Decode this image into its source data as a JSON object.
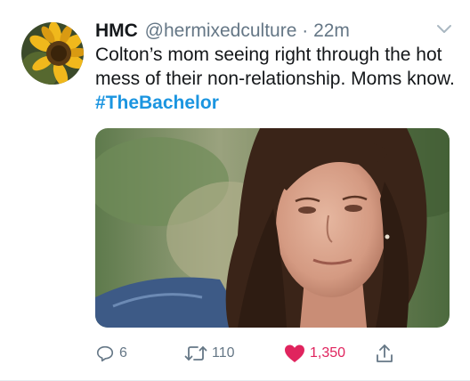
{
  "tweet": {
    "display_name": "HMC",
    "handle": "@hermixedculture",
    "separator": "·",
    "time": "22m",
    "text": "Colton’s mom seeing right through the hot mess of their non-relationship. Moms know. ",
    "hashtag": "#TheBachelor",
    "media_icon": "photo-of-woman"
  },
  "actions": {
    "reply": {
      "icon": "reply-icon",
      "count": "6"
    },
    "retweet": {
      "icon": "retweet-icon",
      "count": "110"
    },
    "like": {
      "icon": "heart-icon",
      "count": "1,350",
      "color": "#e0245e"
    },
    "share": {
      "icon": "share-icon"
    }
  },
  "colors": {
    "link": "#1b95e0",
    "secondary": "#657786",
    "like": "#e0245e"
  }
}
